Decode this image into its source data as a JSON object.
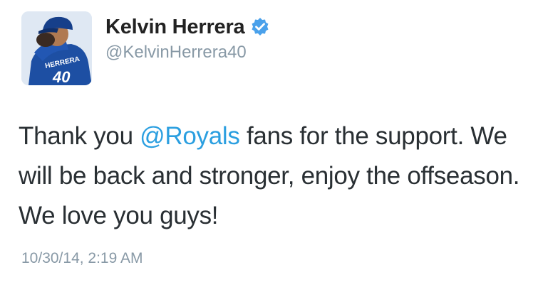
{
  "author": {
    "display_name": "Kelvin Herrera",
    "handle": "@KelvinHerrera40",
    "verified": true,
    "avatar": {
      "jersey_name": "HERRERA",
      "jersey_number": "40"
    }
  },
  "tweet": {
    "text_before": "Thank you ",
    "mention": "@Royals",
    "text_after": " fans for the support. We will be back and stronger, enjoy the offseason. We love you guys!",
    "timestamp": "10/30/14, 2:19 AM"
  },
  "colors": {
    "mention": "#2b9fe0",
    "verified_badge": "#4aa1eb",
    "text": "#292f33",
    "muted": "#8899a6"
  },
  "icons": [
    "verified-badge-icon"
  ]
}
